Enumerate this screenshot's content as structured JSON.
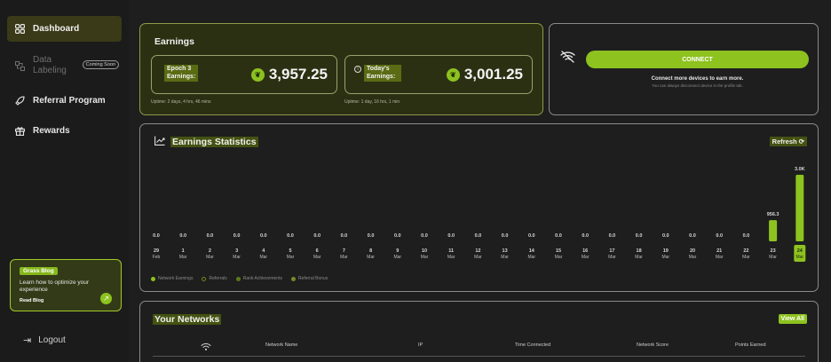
{
  "sidebar": {
    "items": [
      {
        "label": "Dashboard",
        "icon": "dashboard-grid-icon"
      },
      {
        "label": "Data Labeling",
        "icon": "data-labeling-icon",
        "badge": "Coming Soon"
      },
      {
        "label": "Referral Program",
        "icon": "rocket-icon"
      },
      {
        "label": "Rewards",
        "icon": "gift-icon"
      }
    ],
    "blog": {
      "tag": "Grass Blog",
      "text": "Learn how to optimize your experience",
      "read": "Read Blog"
    },
    "logout": "Logout"
  },
  "earnings": {
    "title": "Earnings",
    "epoch_label": "Epoch 3 Earnings:",
    "epoch_value": "3,957.25",
    "epoch_uptime": "Uptime: 2 days, 4 hrs, 46 mins",
    "today_label": "Today's Earnings:",
    "today_value": "3,001.25",
    "today_uptime": "Uptime: 1 day, 16 hrs, 1 min"
  },
  "connect": {
    "button": "CONNECT",
    "message": "Connect more devices to earn more.",
    "sub": "You can always disconnect device in the profile tab."
  },
  "stats": {
    "title": "Earnings Statistics",
    "refresh": "Refresh",
    "legend": [
      {
        "label": "Network Earnings",
        "color": "#8dc21f",
        "filled": true
      },
      {
        "label": "Referrals",
        "color": "#6f8a1a",
        "filled": false
      },
      {
        "label": "Rank Achievements",
        "color": "#5c7a18",
        "filled": true
      },
      {
        "label": "Referral Bonus",
        "color": "#7a8a2a",
        "filled": true
      }
    ]
  },
  "chart_data": {
    "type": "bar",
    "categories": [
      "29 Feb",
      "1 Mar",
      "2 Mar",
      "3 Mar",
      "4 Mar",
      "5 Mar",
      "6 Mar",
      "7 Mar",
      "8 Mar",
      "9 Mar",
      "10 Mar",
      "11 Mar",
      "12 Mar",
      "13 Mar",
      "14 Mar",
      "15 Mar",
      "16 Mar",
      "17 Mar",
      "18 Mar",
      "19 Mar",
      "20 Mar",
      "21 Mar",
      "22 Mar",
      "23 Mar",
      "24 Mar"
    ],
    "day_labels": [
      "29",
      "1",
      "2",
      "3",
      "4",
      "5",
      "6",
      "7",
      "8",
      "9",
      "10",
      "11",
      "12",
      "13",
      "14",
      "15",
      "16",
      "17",
      "18",
      "19",
      "20",
      "21",
      "22",
      "23",
      "24"
    ],
    "month_labels": [
      "Feb",
      "Mar",
      "Mar",
      "Mar",
      "Mar",
      "Mar",
      "Mar",
      "Mar",
      "Mar",
      "Mar",
      "Mar",
      "Mar",
      "Mar",
      "Mar",
      "Mar",
      "Mar",
      "Mar",
      "Mar",
      "Mar",
      "Mar",
      "Mar",
      "Mar",
      "Mar",
      "Mar",
      "Mar"
    ],
    "values": [
      0,
      0,
      0,
      0,
      0,
      0,
      0,
      0,
      0,
      0,
      0,
      0,
      0,
      0,
      0,
      0,
      0,
      0,
      0,
      0,
      0,
      0,
      0,
      956.3,
      3001.25
    ],
    "data_labels": [
      "0.0",
      "0.0",
      "0.0",
      "0.0",
      "0.0",
      "0.0",
      "0.0",
      "0.0",
      "0.0",
      "0.0",
      "0.0",
      "0.0",
      "0.0",
      "0.0",
      "0.0",
      "0.0",
      "0.0",
      "0.0",
      "0.0",
      "0.0",
      "0.0",
      "0.0",
      "0.0",
      "956.3",
      "3.0K"
    ],
    "highlight_index": 24,
    "ylim": [
      0,
      3001.25
    ],
    "bar_color": "#8dc21f",
    "title": "Earnings Statistics",
    "xlabel": "",
    "ylabel": ""
  },
  "networks": {
    "title": "Your Networks",
    "view_all": "View All",
    "columns": [
      "Network Name",
      "IP",
      "Time Connected",
      "Network Score",
      "Points Earned"
    ]
  }
}
